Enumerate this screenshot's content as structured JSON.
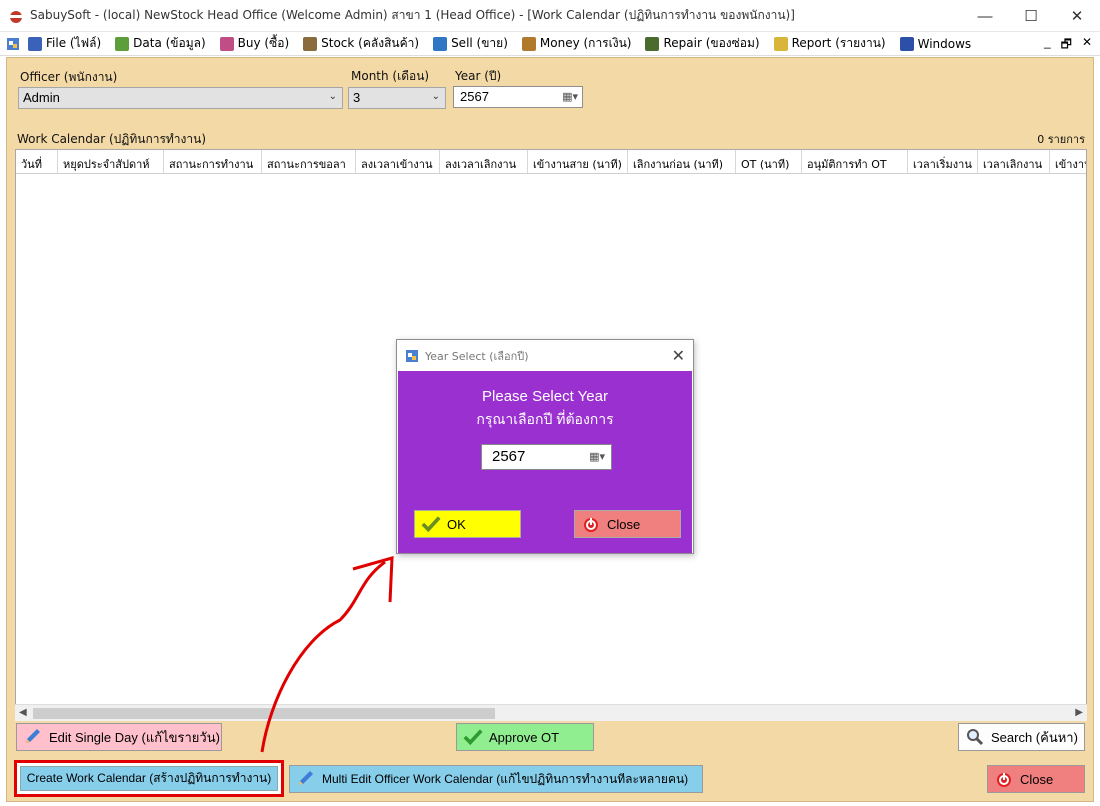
{
  "window": {
    "title": "SabuySoft - (local) NewStock Head Office (Welcome Admin) สาขา 1 (Head Office) - [Work Calendar (ปฏิทินการทำงาน ของพนักงาน)]",
    "minimize": "—",
    "maximize": "☐",
    "close": "✕"
  },
  "menu": {
    "items": [
      {
        "label": "File (ไฟล์)",
        "icon": "file-icon",
        "color": "#3a62b8"
      },
      {
        "label": "Data (ข้อมูล)",
        "icon": "data-icon",
        "color": "#5c9e3a"
      },
      {
        "label": "Buy (ซื้อ)",
        "icon": "buy-icon",
        "color": "#c04d86"
      },
      {
        "label": "Stock (คลังสินค้า)",
        "icon": "stock-icon",
        "color": "#8a6b3d"
      },
      {
        "label": "Sell (ขาย)",
        "icon": "sell-icon",
        "color": "#2f77c4"
      },
      {
        "label": "Money (การเงิน)",
        "icon": "money-icon",
        "color": "#b07a2a"
      },
      {
        "label": "Repair (ของซ่อม)",
        "icon": "repair-icon",
        "color": "#4b6b2e"
      },
      {
        "label": "Report (รายงาน)",
        "icon": "report-icon",
        "color": "#d9b53a"
      },
      {
        "label": "Windows",
        "icon": "windows-icon",
        "color": "#2c4fa8"
      }
    ],
    "mdi_minimize": "_",
    "mdi_restore": "🗗",
    "mdi_close": "✕"
  },
  "filters": {
    "officer_label": "Officer (พนักงาน)",
    "officer_value": "Admin",
    "month_label": "Month (เดือน)",
    "month_value": "3",
    "year_label": "Year (ปี)",
    "year_value": "2567"
  },
  "grid": {
    "title": "Work Calendar (ปฏิทินการทำงาน)",
    "count": "0 รายการ",
    "columns": [
      "วันที่",
      "หยุดประจำสัปดาห์",
      "สถานะการทำงาน",
      "สถานะการขอลา",
      "ลงเวลาเข้างาน",
      "ลงเวลาเลิกงาน",
      "เข้างานสาย (นาที)",
      "เลิกงานก่อน (นาที)",
      "OT (นาที)",
      "อนุมัติการทำ OT",
      "เวลาเริ่มงาน",
      "เวลาเลิกงาน",
      "เข้างานเ"
    ],
    "rows": []
  },
  "buttons": {
    "edit_single_day": "Edit Single Day (แก้ไขรายวัน)",
    "approve_ot": "Approve OT",
    "search": "Search (ค้นหา)",
    "create_calendar": "Create Work Calendar (สร้างปฏิทินการทำงาน)",
    "multi_edit": "Multi Edit Officer Work Calendar (แก้ไขปฏิทินการทำงานทีละหลายคน)",
    "close": "Close"
  },
  "dialog": {
    "title": "Year Select (เลือกปี)",
    "heading": "Please Select Year",
    "subheading": "กรุณาเลือกปี ที่ต้องการ",
    "year_value": "2567",
    "ok": "OK",
    "close": "Close"
  },
  "colors": {
    "client_bg": "#f3d9a6",
    "dialog_bg": "#9b30d0",
    "ok_bg": "#ffff00",
    "close_bg": "#f08080",
    "approve_bg": "#90ee90",
    "create_bg": "#87ceeb",
    "edit_bg": "#ffc0cb",
    "annotation": "#e00000"
  }
}
